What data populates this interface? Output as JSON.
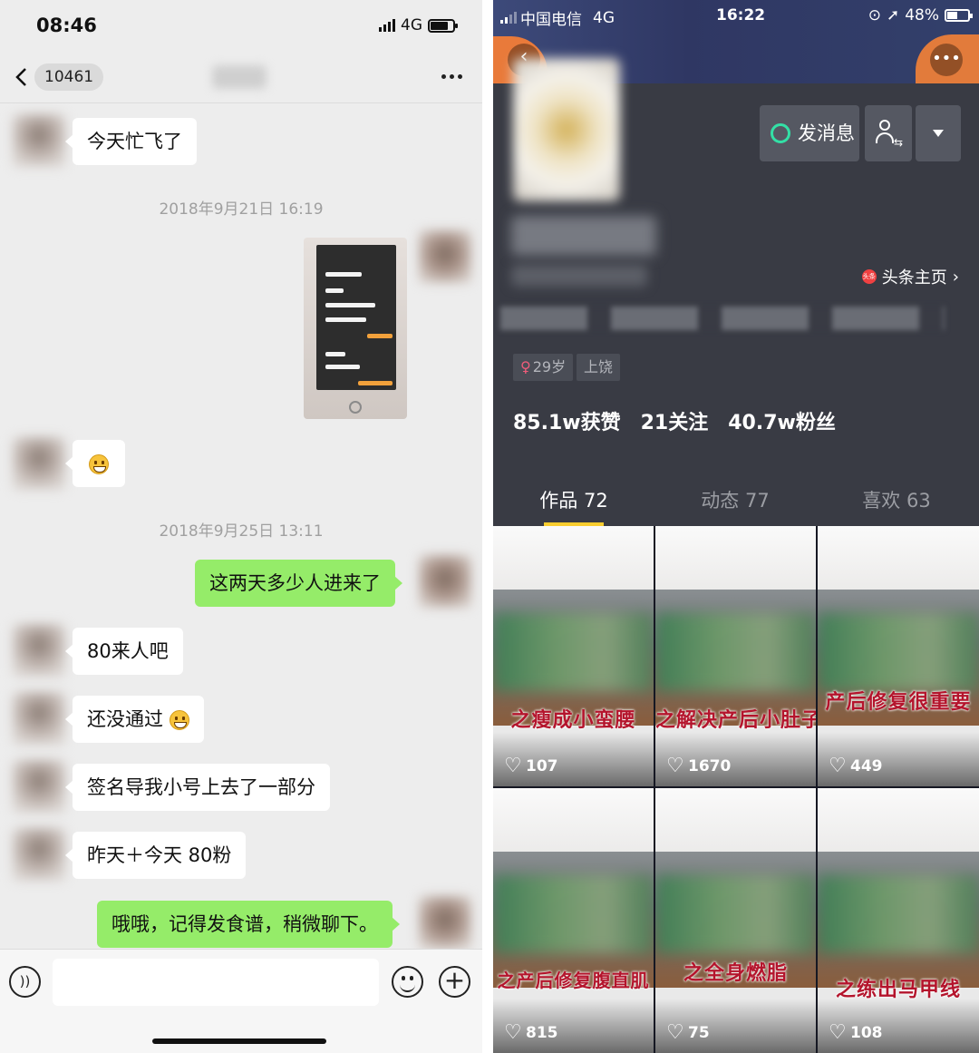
{
  "left_panel": {
    "status_bar": {
      "time": "08:46",
      "network": "4G"
    },
    "nav": {
      "unread_count": "10461"
    },
    "messages": [
      {
        "side": "in",
        "text": "今天忙飞了"
      },
      {
        "timestamp": "2018年9月21日 16:19"
      },
      {
        "side": "out",
        "type": "image"
      },
      {
        "side": "in",
        "type": "emoji"
      },
      {
        "timestamp": "2018年9月25日 13:11"
      },
      {
        "side": "out",
        "text": "这两天多少人进来了"
      },
      {
        "side": "in",
        "text": "80来人吧"
      },
      {
        "side": "in",
        "text": "还没通过"
      },
      {
        "side": "in",
        "text": "签名导我小号上去了一部分"
      },
      {
        "side": "in",
        "text": "昨天＋今天 80粉"
      },
      {
        "side": "out",
        "text": "哦哦，记得发食谱，稍微聊下。"
      }
    ],
    "input_bar": {
      "placeholder": ""
    },
    "colors": {
      "background": "#ededed",
      "outgoing_bubble": "#95ec69",
      "incoming_bubble": "#ffffff"
    }
  },
  "right_panel": {
    "status_bar": {
      "carrier": "中国电信",
      "network": "4G",
      "time": "16:22",
      "battery": "48%"
    },
    "buttons": {
      "message": "发消息"
    },
    "toutiao_link": "头条主页",
    "toutiao_badge": "头条",
    "tags": {
      "age": "29岁",
      "location": "上饶"
    },
    "stats": {
      "likes": "85.1w获赞",
      "following": "21关注",
      "followers": "40.7w粉丝"
    },
    "tabs": [
      "作品 72",
      "动态 77",
      "喜欢 63"
    ],
    "active_tab": 0,
    "videos": [
      {
        "caption": "之瘦成小蛮腰",
        "likes": "107"
      },
      {
        "caption": "之解决产后小肚子",
        "likes": "1670"
      },
      {
        "caption": "产后修复很重要",
        "likes": "449"
      },
      {
        "caption": "之产后修复腹直肌",
        "likes": "815"
      },
      {
        "caption": "之全身燃脂",
        "likes": "75"
      },
      {
        "caption": "之练出马甲线",
        "likes": "108"
      }
    ],
    "colors": {
      "page_bg": "#161823",
      "profile_bg": "#393b44",
      "tab_underline": "#facd2f",
      "message_icon": "#33e0a6",
      "caption": "#b4142c"
    }
  }
}
